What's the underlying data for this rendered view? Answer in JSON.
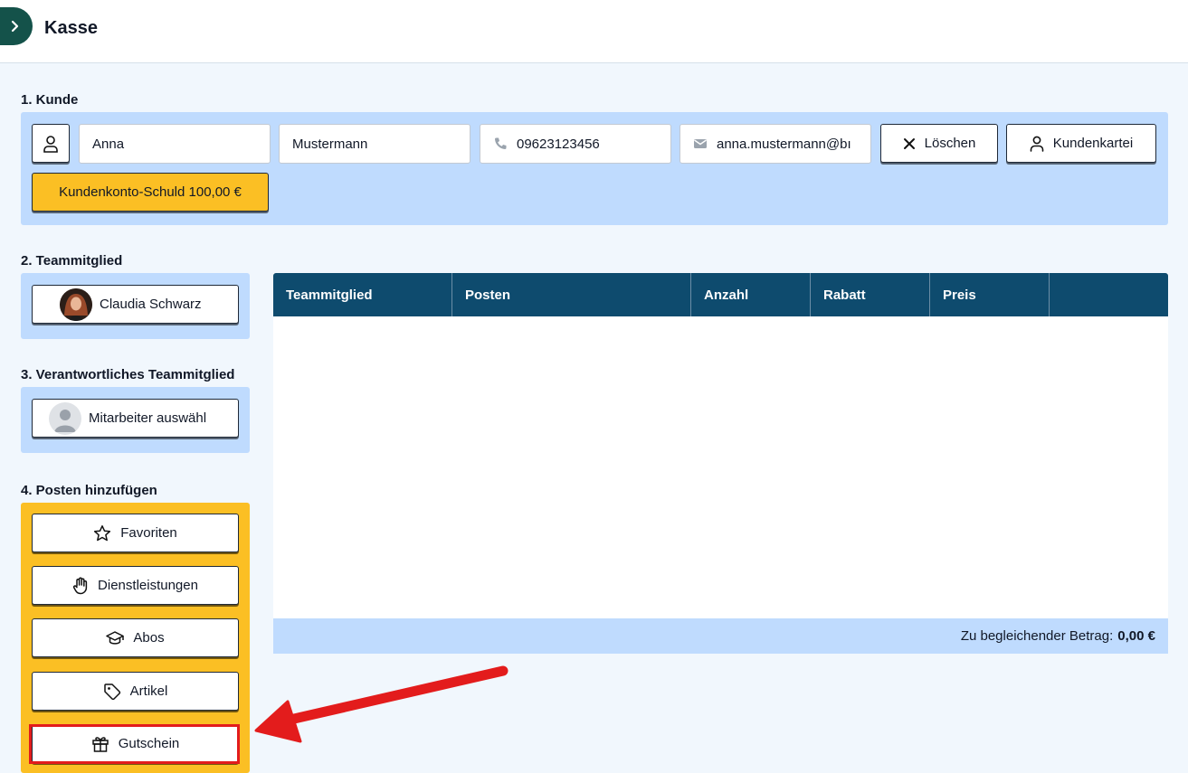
{
  "header": {
    "title": "Kasse"
  },
  "customer": {
    "section_label": "1. Kunde",
    "first_name": "Anna",
    "last_name": "Mustermann",
    "phone": "09623123456",
    "email": "anna.mustermann@bı",
    "delete_label": "Löschen",
    "customer_file_label": "Kundenkartei",
    "debt_label": "Kundenkonto-Schuld 100,00 €"
  },
  "team_member": {
    "section_label": "2. Teammitglied",
    "name": "Claudia Schwarz"
  },
  "responsible_member": {
    "section_label": "3. Verantwortliches Teammitglied",
    "select_label": "Mitarbeiter auswähl"
  },
  "add_items": {
    "section_label": "4. Posten hinzufügen",
    "items": [
      {
        "label": "Favoriten",
        "icon": "star-icon"
      },
      {
        "label": "Dienstleistungen",
        "icon": "hand-icon"
      },
      {
        "label": "Abos",
        "icon": "graduation-cap-icon"
      },
      {
        "label": "Artikel",
        "icon": "tag-icon"
      },
      {
        "label": "Gutschein",
        "icon": "gift-icon"
      }
    ]
  },
  "table": {
    "columns": [
      "Teammitglied",
      "Posten",
      "Anzahl",
      "Rabatt",
      "Preis",
      ""
    ],
    "rows": [],
    "total_label": "Zu begleichender Betrag:",
    "total_value": "0,00 €"
  },
  "colors": {
    "header_toggle": "#14524a",
    "table_header": "#0e4b6e",
    "panel_blue": "#bfdbfe",
    "panel_yellow": "#fbbf24",
    "highlight_red": "#e31c1c"
  }
}
